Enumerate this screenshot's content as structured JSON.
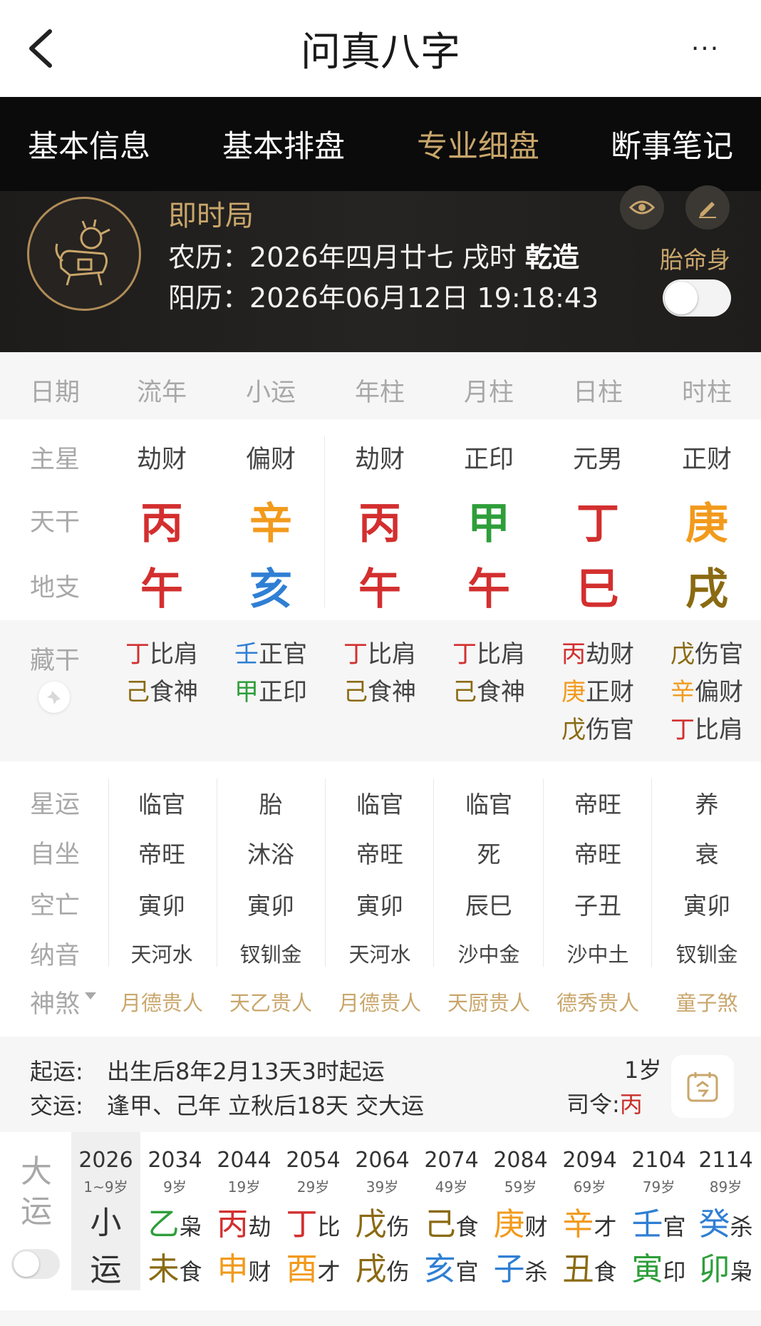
{
  "nav": {
    "title": "问真八字",
    "more": "···"
  },
  "tabs": [
    "基本信息",
    "基本排盘",
    "专业细盘",
    "断事笔记"
  ],
  "header": {
    "kind": "即时局",
    "lunar_label": "农历：",
    "lunar": "2026年四月廿七 戌时",
    "gender": "乾造",
    "solar_label": "阳历：",
    "solar": "2026年06月12日 19:18:43",
    "toggle_label": "胎命身"
  },
  "columns": [
    "流年",
    "小运",
    "年柱",
    "月柱",
    "日柱",
    "时柱"
  ],
  "labels": {
    "date": "日期",
    "main_star": "主星",
    "stem": "天干",
    "branch": "地支",
    "hidden": "藏干",
    "xingyun": "星运",
    "zizuo": "自坐",
    "kongwang": "空亡",
    "nayin": "纳音",
    "shensha": "神煞"
  },
  "main_star": [
    "劫财",
    "偏财",
    "劫财",
    "正印",
    "元男",
    "正财"
  ],
  "stems": [
    "丙",
    "辛",
    "丙",
    "甲",
    "丁",
    "庚"
  ],
  "branches": [
    "午",
    "亥",
    "午",
    "午",
    "巳",
    "戌"
  ],
  "hidden": [
    [
      {
        "c": "丁",
        "t": "比肩"
      },
      {
        "c": "己",
        "t": "食神"
      }
    ],
    [
      {
        "c": "壬",
        "t": "正官"
      },
      {
        "c": "甲",
        "t": "正印"
      }
    ],
    [
      {
        "c": "丁",
        "t": "比肩"
      },
      {
        "c": "己",
        "t": "食神"
      }
    ],
    [
      {
        "c": "丁",
        "t": "比肩"
      },
      {
        "c": "己",
        "t": "食神"
      }
    ],
    [
      {
        "c": "丙",
        "t": "劫财"
      },
      {
        "c": "庚",
        "t": "正财"
      },
      {
        "c": "戊",
        "t": "伤官"
      }
    ],
    [
      {
        "c": "戊",
        "t": "伤官"
      },
      {
        "c": "辛",
        "t": "偏财"
      },
      {
        "c": "丁",
        "t": "比肩"
      }
    ]
  ],
  "xingyun": [
    "临官",
    "胎",
    "临官",
    "临官",
    "帝旺",
    "养"
  ],
  "zizuo": [
    "帝旺",
    "沐浴",
    "帝旺",
    "死",
    "帝旺",
    "衰"
  ],
  "kongwang": [
    "寅卯",
    "寅卯",
    "寅卯",
    "辰巳",
    "子丑",
    "寅卯"
  ],
  "nayin": [
    "天河水",
    "钗钏金",
    "天河水",
    "沙中金",
    "沙中土",
    "钗钏金"
  ],
  "shensha": [
    "月德贵人",
    "天乙贵人",
    "月德贵人",
    "天厨贵人",
    "德秀贵人",
    "童子煞"
  ],
  "qiyun": {
    "l1": "起运:",
    "v1": "出生后8年2月13天3时起运",
    "l2": "交运:",
    "v2": "逢甲、己年 立秋后18天 交大运",
    "age": "1岁",
    "siling_label": "司令:",
    "siling": "丙"
  },
  "dayun": {
    "label1": "大",
    "label2": "运",
    "xiaoyun1": "小",
    "xiaoyun2": "运",
    "cols": [
      {
        "year": "2026",
        "age": "1~9岁"
      },
      {
        "year": "2034",
        "age": "9岁",
        "g": "乙",
        "gt": "枭",
        "z": "未",
        "zt": "食"
      },
      {
        "year": "2044",
        "age": "19岁",
        "g": "丙",
        "gt": "劫",
        "z": "申",
        "zt": "财"
      },
      {
        "year": "2054",
        "age": "29岁",
        "g": "丁",
        "gt": "比",
        "z": "酉",
        "zt": "才"
      },
      {
        "year": "2064",
        "age": "39岁",
        "g": "戊",
        "gt": "伤",
        "z": "戌",
        "zt": "伤"
      },
      {
        "year": "2074",
        "age": "49岁",
        "g": "己",
        "gt": "食",
        "z": "亥",
        "zt": "官"
      },
      {
        "year": "2084",
        "age": "59岁",
        "g": "庚",
        "gt": "财",
        "z": "子",
        "zt": "杀"
      },
      {
        "year": "2094",
        "age": "69岁",
        "g": "辛",
        "gt": "才",
        "z": "丑",
        "zt": "食"
      },
      {
        "year": "2104",
        "age": "79岁",
        "g": "壬",
        "gt": "官",
        "z": "寅",
        "zt": "印"
      },
      {
        "year": "2114",
        "age": "89岁",
        "g": "癸",
        "gt": "杀",
        "z": "卯",
        "zt": "枭"
      }
    ]
  },
  "colors": {
    "gold": "#c9a66b",
    "fire": "#d32f2f",
    "metal": "#f29a1c",
    "wood": "#2e9e3a",
    "water": "#2f7fd4",
    "earth": "#8a6a12"
  },
  "icons": [
    "back-arrow-icon",
    "more-icon",
    "rooster-avatar-icon",
    "eye-icon",
    "pencil-icon",
    "pin-icon",
    "calendar-today-icon"
  ]
}
